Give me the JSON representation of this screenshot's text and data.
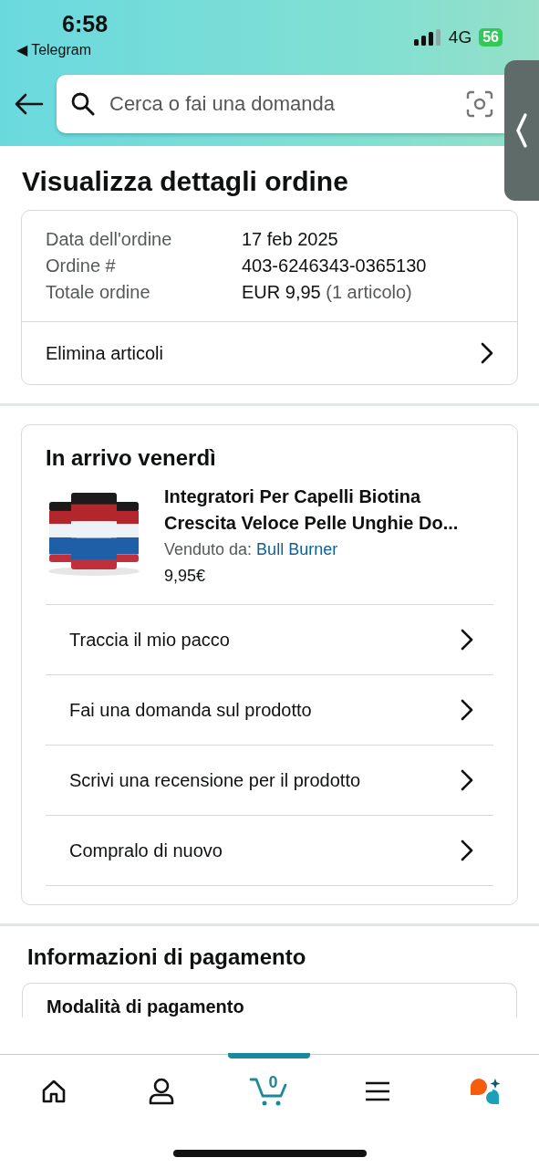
{
  "status_bar": {
    "time": "6:58",
    "back_app": "◀ Telegram",
    "network": "4G",
    "battery": "56"
  },
  "search": {
    "placeholder": "Cerca o fai una domanda"
  },
  "title": "Visualizza dettagli ordine",
  "order_summary": {
    "rows": [
      {
        "label": "Data dell'ordine",
        "value": "17 feb 2025"
      },
      {
        "label": "Ordine #",
        "value": "403-6246343-0365130"
      },
      {
        "label": "Totale ordine",
        "value": "EUR 9,95",
        "note": "(1 articolo)"
      }
    ],
    "action": "Elimina articoli"
  },
  "shipment": {
    "heading": "In arrivo venerdì",
    "product": {
      "kind": "picture",
      "name_lines": [
        "Integratori Per Capelli Biotina",
        "Crescita Veloce Pelle Unghie Do..."
      ],
      "seller_label": "Venduto da:",
      "seller": "Bull Burner",
      "price": "9,95€"
    },
    "actions": [
      "Traccia il mio pacco",
      "Fai una domanda sul prodotto",
      "Scrivi una recensione per il prodotto",
      "Compralo di nuovo"
    ]
  },
  "payment": {
    "heading": "Informazioni di pagamento",
    "method_heading": "Modalità di pagamento"
  },
  "bottom_nav": [
    {
      "kind": "home",
      "selected": false
    },
    {
      "kind": "account",
      "selected": false
    },
    {
      "kind": "cart",
      "selected": true,
      "count": "0"
    },
    {
      "kind": "menu",
      "selected": false
    },
    {
      "kind": "assistant",
      "selected": false
    }
  ]
}
